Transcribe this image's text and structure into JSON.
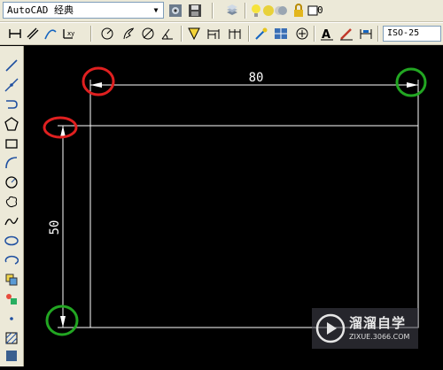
{
  "toolbar_top": {
    "workspace_value": "AutoCAD 经典",
    "current_layer": "0"
  },
  "toolbar_dim": {
    "dim_style_value": "ISO-25"
  },
  "left_toolbar": {
    "tools": [
      "line",
      "construction-line",
      "polyline",
      "polygon",
      "rectangle",
      "arc",
      "circle",
      "revision-cloud",
      "spline",
      "ellipse",
      "ellipse-arc",
      "insert-block",
      "make-block",
      "point",
      "hatch",
      "gradient"
    ]
  },
  "drawing": {
    "horizontal_dimension": "80",
    "vertical_dimension": "50",
    "colors": {
      "canvas": "#000000",
      "geometry": "#ffffff",
      "marker_red": "#e02020",
      "marker_green": "#22a622"
    }
  },
  "watermark": {
    "title": "溜溜自学",
    "url": "ZIXUE.3066.COM"
  }
}
